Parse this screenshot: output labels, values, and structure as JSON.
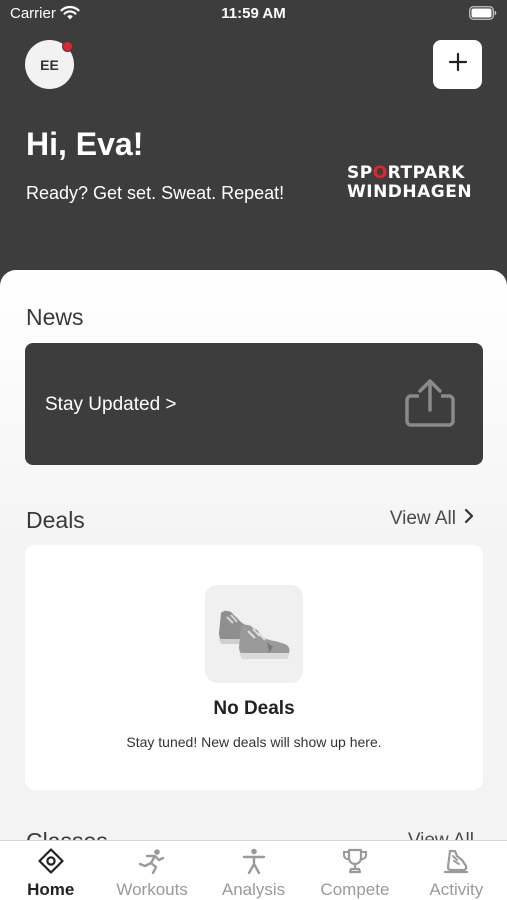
{
  "status_bar": {
    "carrier": "Carrier",
    "time": "11:59 AM"
  },
  "profile": {
    "initials": "EE",
    "has_notification": true,
    "notification_color": "#e52330"
  },
  "header": {
    "greeting": "Hi, Eva!",
    "tagline": "Ready? Get set. Sweat. Repeat!",
    "background_color": "#3d3d3d",
    "add_icon": "plus-icon"
  },
  "brand": {
    "line1_a": "SP",
    "line1_accent": "O",
    "line1_b": "RTPARK",
    "line2": "WINDHAGEN",
    "accent_color": "#e52330"
  },
  "news": {
    "title": "News",
    "card_label": "Stay Updated >",
    "card_icon": "share-icon"
  },
  "deals": {
    "title": "Deals",
    "view_all": "View All",
    "empty_title": "No Deals",
    "empty_text": "Stay tuned! New deals will show up here.",
    "empty_icon": "sneakers-icon"
  },
  "next_section": {
    "title": "Classes",
    "view_all": "View All"
  },
  "tabs": [
    {
      "label": "Home",
      "icon": "home-icon",
      "active": true
    },
    {
      "label": "Workouts",
      "icon": "workouts-icon",
      "active": false
    },
    {
      "label": "Analysis",
      "icon": "analysis-icon",
      "active": false
    },
    {
      "label": "Compete",
      "icon": "trophy-icon",
      "active": false
    },
    {
      "label": "Activity",
      "icon": "activity-icon",
      "active": false
    }
  ]
}
